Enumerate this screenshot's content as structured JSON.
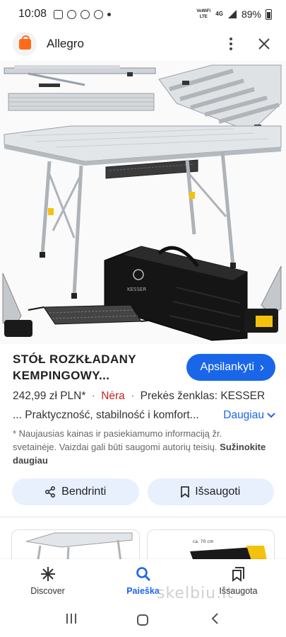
{
  "status_bar": {
    "time": "10:08",
    "network_top": "VoWiFi LTE",
    "network_4g": "4G",
    "battery": "89%"
  },
  "header": {
    "site_name": "Allegro",
    "favicon": "allegro-bag-icon",
    "accent_color": "#ff6a1a"
  },
  "product": {
    "title": "STÓŁ ROZKŁADANY KEMPINGOWY...",
    "visit_label": "Apsilankyti",
    "price": "242,99 zł PLN*",
    "stock": "Nėra",
    "brand": "Prekės ženklas: KESSER",
    "description": "... Praktyczność, stabilność i komfort...",
    "more_label": "Daugiau",
    "disclaimer": "* Naujausias kainas ir pasiekiamumo informaciją žr. svetainėje. Vaizdai gali būti saugomi autorių teisių.",
    "learn_more": "Sužinokite daugiau",
    "bag_brand": "KESSER"
  },
  "actions": {
    "share_label": "Bendrinti",
    "save_label": "Išsaugoti"
  },
  "thumbnail_2_text": "ca. 70 cm",
  "nav": {
    "items": [
      {
        "label": "Discover",
        "icon": "asterisk-icon"
      },
      {
        "label": "Paieška",
        "icon": "search-icon"
      },
      {
        "label": "Išsaugota",
        "icon": "bookmarks-icon"
      }
    ]
  },
  "watermark": "skelbiu.lt",
  "colors": {
    "primary": "#1a66e8",
    "stock_red": "#c5221f",
    "chip_bg": "#e8f0fe"
  }
}
